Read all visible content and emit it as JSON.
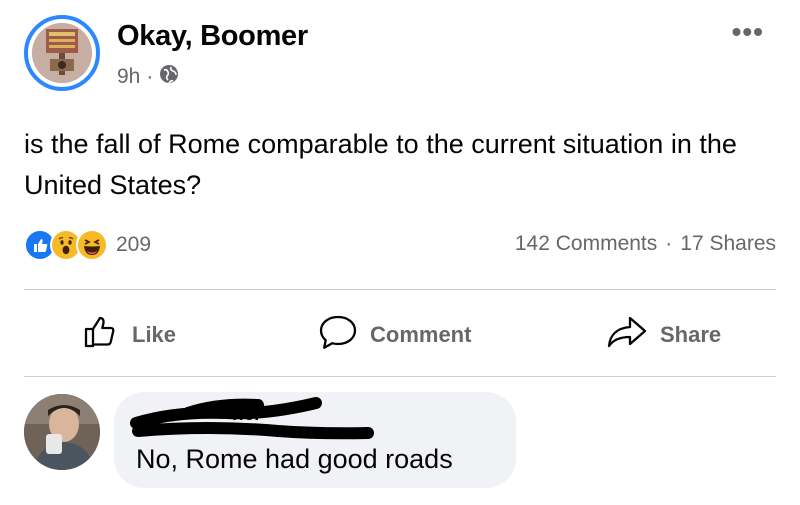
{
  "post": {
    "page_name": "Okay, Boomer",
    "time": "9h",
    "separator": "·",
    "privacy_icon": "globe-icon",
    "more_label": "•••",
    "text": "is the fall of Rome comparable to the current situation in the United States?",
    "reactions": {
      "icons": [
        "like-icon",
        "wow-icon",
        "haha-icon"
      ],
      "count": "209"
    },
    "comments_count": "142 Comments",
    "shares_count": "17 Shares"
  },
  "actions": {
    "like": "Like",
    "comment": "Comment",
    "share": "Share"
  },
  "comment": {
    "author": "ner",
    "text": "No, Rome had good roads"
  },
  "colors": {
    "accent": "#2d88ff",
    "secondary_text": "#65676b",
    "bubble": "#f0f2f5",
    "like_blue": "#1877f2",
    "emoji_yellow": "#f7b928"
  }
}
